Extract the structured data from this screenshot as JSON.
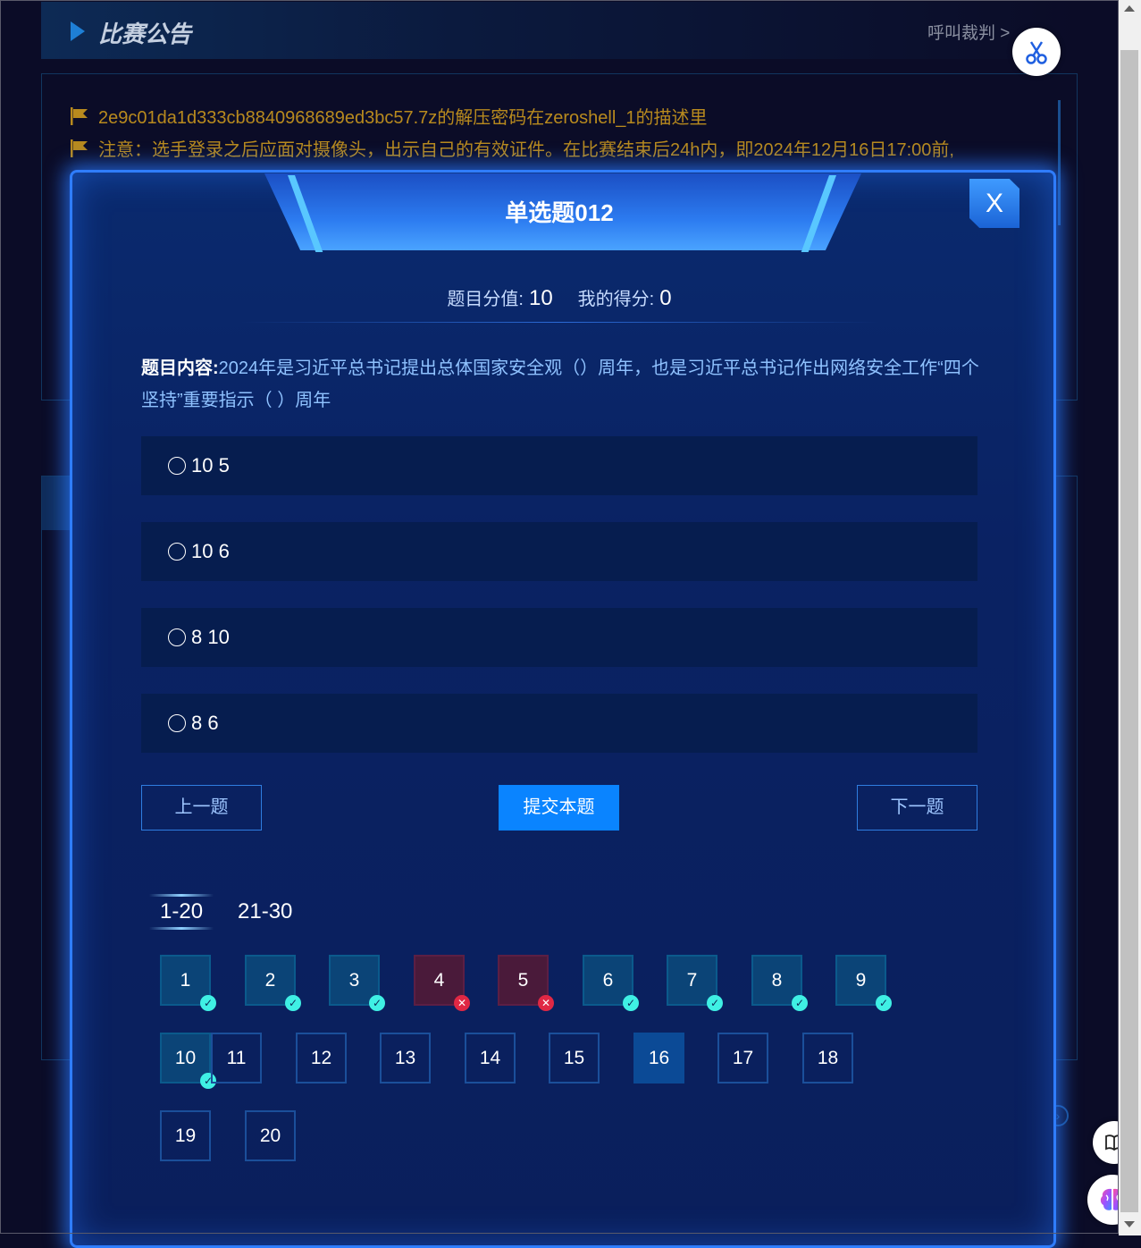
{
  "background": {
    "header_title": "比赛公告",
    "referee_link": "呼叫裁判 >",
    "notices": [
      "2e9c01da1d333cb8840968689ed3bc57.7z的解压密码在zeroshell_1的描述里",
      "注意：选手登录之后应面对摄像头，出示自己的有效证件。在比赛结束后24h内，即2024年12月16日17:00前,"
    ]
  },
  "modal": {
    "title": "单选题012",
    "close_label": "X",
    "score_label": "题目分值:",
    "score_value": "10",
    "my_score_label": "我的得分:",
    "my_score_value": "0",
    "question_label": "题目内容:",
    "question_text": "2024年是习近平总书记提出总体国家安全观（）周年，也是习近平总书记作出网络安全工作“四个坚持”重要指示（ ）周年",
    "options": [
      "10 5",
      "10 6",
      "8 10",
      "8 6"
    ],
    "prev_label": "上一题",
    "submit_label": "提交本题",
    "next_label": "下一题",
    "ranges": [
      "1-20",
      "21-30"
    ],
    "active_range": "1-20",
    "questions": [
      {
        "num": "1",
        "status": "correct"
      },
      {
        "num": "2",
        "status": "correct"
      },
      {
        "num": "3",
        "status": "correct"
      },
      {
        "num": "4",
        "status": "wrong"
      },
      {
        "num": "5",
        "status": "wrong"
      },
      {
        "num": "6",
        "status": "correct"
      },
      {
        "num": "7",
        "status": "correct"
      },
      {
        "num": "8",
        "status": "correct"
      },
      {
        "num": "9",
        "status": "correct"
      },
      {
        "num": "10",
        "status": "correct"
      },
      {
        "num": "11",
        "status": "pending"
      },
      {
        "num": "12",
        "status": "pending"
      },
      {
        "num": "13",
        "status": "pending"
      },
      {
        "num": "14",
        "status": "pending"
      },
      {
        "num": "15",
        "status": "pending"
      },
      {
        "num": "16",
        "status": "current"
      },
      {
        "num": "17",
        "status": "pending"
      },
      {
        "num": "18",
        "status": "pending"
      },
      {
        "num": "19",
        "status": "pending"
      },
      {
        "num": "20",
        "status": "pending"
      }
    ]
  },
  "icons": {
    "scissor": "scissor-icon",
    "book": "book-icon",
    "brain": "brain-icon",
    "flag": "flag-icon",
    "check": "check-icon",
    "cross": "cross-icon"
  },
  "colors": {
    "accent": "#0a84ff",
    "correct": "#3ff0e4",
    "wrong": "#e02844",
    "notice": "#b88a1e"
  }
}
